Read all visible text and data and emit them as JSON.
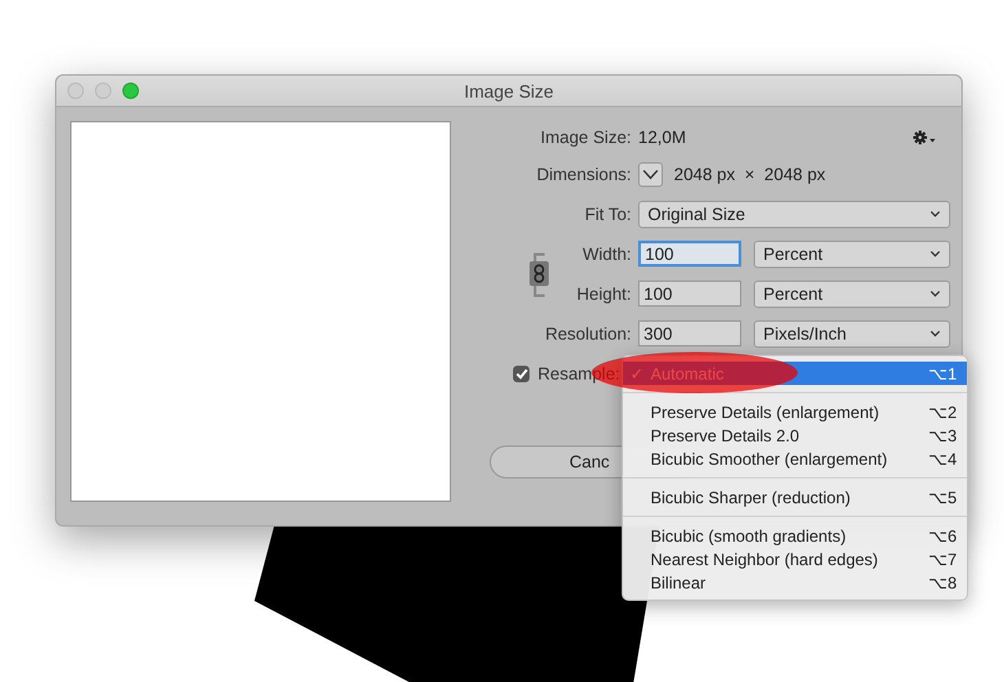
{
  "window": {
    "title": "Image Size"
  },
  "image_size": {
    "label": "Image Size:",
    "value": "12,0M"
  },
  "dimensions": {
    "label": "Dimensions:",
    "value": "2048 px  ×  2048 px"
  },
  "fit_to": {
    "label": "Fit To:",
    "value": "Original Size"
  },
  "fields": [
    {
      "label": "Width:",
      "value": "100",
      "unit": "Percent",
      "focused": true
    },
    {
      "label": "Height:",
      "value": "100",
      "unit": "Percent",
      "focused": false
    },
    {
      "label": "Resolution:",
      "value": "300",
      "unit": "Pixels/Inch",
      "focused": false
    }
  ],
  "resample": {
    "label": "Resample:",
    "checked": true
  },
  "cancel_button": "Canc",
  "menu": {
    "check_mark": "✓",
    "items": [
      {
        "kind": "item",
        "label": "Automatic",
        "shortcut": "⌥1",
        "checked": true,
        "selected": true
      },
      {
        "kind": "separator"
      },
      {
        "kind": "item",
        "label": "Preserve Details (enlargement)",
        "shortcut": "⌥2",
        "checked": false,
        "selected": false
      },
      {
        "kind": "item",
        "label": "Preserve Details 2.0",
        "shortcut": "⌥3",
        "checked": false,
        "selected": false
      },
      {
        "kind": "item",
        "label": "Bicubic Smoother (enlargement)",
        "shortcut": "⌥4",
        "checked": false,
        "selected": false
      },
      {
        "kind": "separator"
      },
      {
        "kind": "item",
        "label": "Bicubic Sharper (reduction)",
        "shortcut": "⌥5",
        "checked": false,
        "selected": false
      },
      {
        "kind": "separator"
      },
      {
        "kind": "item",
        "label": "Bicubic (smooth gradients)",
        "shortcut": "⌥6",
        "checked": false,
        "selected": false
      },
      {
        "kind": "item",
        "label": "Nearest Neighbor (hard edges)",
        "shortcut": "⌥7",
        "checked": false,
        "selected": false
      },
      {
        "kind": "item",
        "label": "Bilinear",
        "shortcut": "⌥8",
        "checked": false,
        "selected": false
      }
    ]
  }
}
